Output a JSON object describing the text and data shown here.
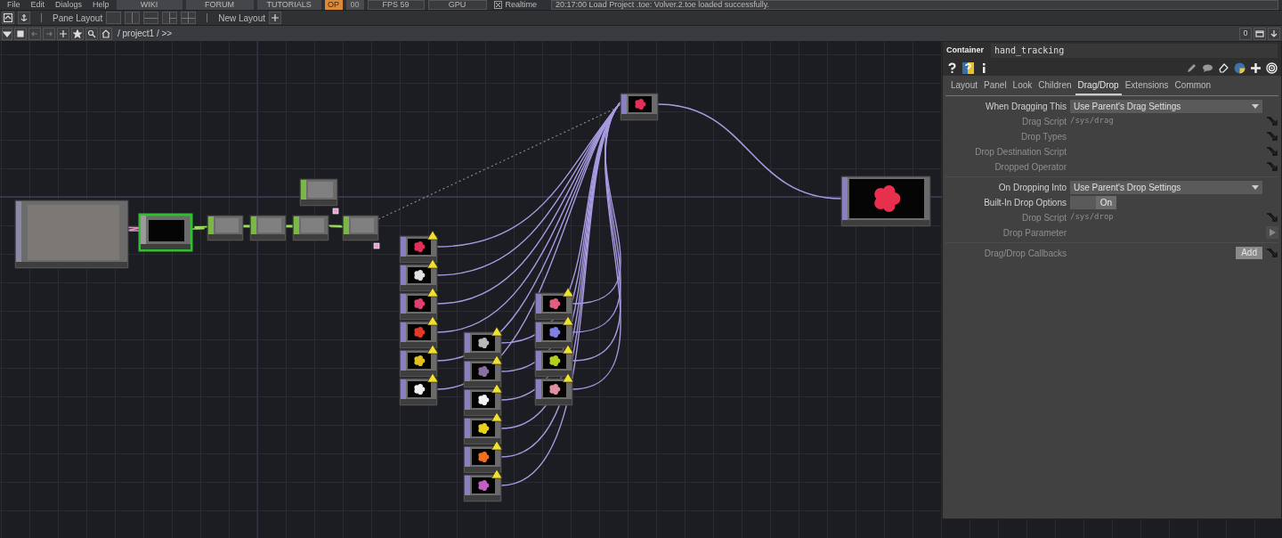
{
  "menu_bar": {
    "menus": [
      "File",
      "Edit",
      "Dialogs",
      "Help"
    ],
    "buttons": [
      {
        "label": "WIKI",
        "kind": "link"
      },
      {
        "label": "FORUM",
        "kind": "link"
      },
      {
        "label": "TUTORIALS",
        "kind": "link"
      },
      {
        "label": "OP",
        "kind": "indicator",
        "on": true
      },
      {
        "label": "00",
        "kind": "indicator",
        "on": false
      },
      {
        "label": "FPS  59",
        "kind": "readout"
      },
      {
        "label": "GPU",
        "kind": "readout"
      }
    ],
    "realtime": {
      "label": "Realtime",
      "checked": true
    },
    "status": "20:17:00 Load Project .toe: Volver.2.toe loaded successfully."
  },
  "pane_toolbar": {
    "label": "Pane Layout",
    "new_layout": "New Layout"
  },
  "path_bar": {
    "path": "/ project1 / >>",
    "counter": "0"
  },
  "network": {
    "nodes": [
      {
        "kind": "webcam",
        "selected": false
      },
      {
        "kind": "container",
        "selected": true
      },
      {
        "kind": "chop",
        "selected": false
      },
      {
        "kind": "chop",
        "selected": false
      },
      {
        "kind": "chop",
        "selected": false
      },
      {
        "kind": "chop",
        "selected": false,
        "flagged": true
      },
      {
        "kind": "chop",
        "selected": false,
        "flagged": true
      },
      {
        "kind": "switch",
        "selected": false,
        "color": "#e0305a"
      },
      {
        "kind": "output",
        "selected": false,
        "color": "#e8304e"
      },
      {
        "kind": "flower",
        "warning": true,
        "selected": false,
        "color": "#e0305a"
      },
      {
        "kind": "flower",
        "warning": true,
        "selected": false,
        "color": "#e0e0e0"
      },
      {
        "kind": "flower",
        "warning": true,
        "selected": false,
        "color": "#e04070"
      },
      {
        "kind": "flower",
        "warning": true,
        "selected": false,
        "color": "#e03a2a"
      },
      {
        "kind": "flower",
        "warning": true,
        "selected": false,
        "color": "#e0c020"
      },
      {
        "kind": "flower",
        "warning": true,
        "selected": false,
        "color": "#f0f0f0"
      },
      {
        "kind": "flower",
        "warning": true,
        "selected": false,
        "color": "#b8b8b8"
      },
      {
        "kind": "flower",
        "warning": true,
        "selected": false,
        "color": "#8a70a0"
      },
      {
        "kind": "flower",
        "warning": true,
        "selected": false,
        "color": "#f2f2f2"
      },
      {
        "kind": "flower",
        "warning": true,
        "selected": false,
        "color": "#e8d020"
      },
      {
        "kind": "flower",
        "warning": true,
        "selected": false,
        "color": "#f07020"
      },
      {
        "kind": "flower",
        "warning": true,
        "selected": false,
        "color": "#c060c0"
      },
      {
        "kind": "flower",
        "warning": true,
        "selected": false,
        "color": "#e06080"
      },
      {
        "kind": "flower",
        "warning": true,
        "selected": false,
        "color": "#8080e0"
      },
      {
        "kind": "flower",
        "warning": true,
        "selected": false,
        "color": "#b0d020"
      },
      {
        "kind": "flower",
        "warning": true,
        "selected": false,
        "color": "#e090a0"
      }
    ]
  },
  "parameters": {
    "type": "Container",
    "name": "hand_tracking",
    "tabs": [
      {
        "label": "Layout",
        "selected": false
      },
      {
        "label": "Panel",
        "selected": false
      },
      {
        "label": "Look",
        "selected": false
      },
      {
        "label": "Children",
        "selected": false
      },
      {
        "label": "Drag/Drop",
        "selected": true
      },
      {
        "label": "Extensions",
        "selected": false
      },
      {
        "label": "Common",
        "selected": false
      }
    ],
    "groups": [
      {
        "rows": [
          {
            "label": "When Dragging This",
            "kind": "menu",
            "value": "Use Parent's Drag Settings",
            "disabled": false,
            "link": false
          },
          {
            "label": "Drag Script",
            "kind": "text",
            "value": "/sys/drag",
            "disabled": true,
            "link": true
          },
          {
            "label": "Drop Types",
            "kind": "text",
            "disabled": true,
            "link": true
          },
          {
            "label": "Drop Destination Script",
            "kind": "text",
            "disabled": true,
            "link": true
          },
          {
            "label": "Dropped Operator",
            "kind": "text",
            "disabled": true,
            "link": true
          }
        ]
      },
      {
        "rows": [
          {
            "label": "On Dropping Into",
            "kind": "menu",
            "value": "Use Parent's Drop Settings",
            "disabled": false,
            "link": false
          },
          {
            "label": "Built-In Drop Options",
            "kind": "toggle",
            "value": "On",
            "on": true,
            "disabled": false,
            "link": false
          },
          {
            "label": "Drop Script",
            "kind": "text",
            "value": "/sys/drop",
            "disabled": true,
            "link": true
          },
          {
            "label": "Drop Parameter",
            "kind": "pulse",
            "disabled": true,
            "link": false
          }
        ]
      },
      {
        "rows": [
          {
            "label": "Drag/Drop Callbacks",
            "kind": "button",
            "value": "Add",
            "disabled": true,
            "link": true
          }
        ]
      }
    ]
  }
}
